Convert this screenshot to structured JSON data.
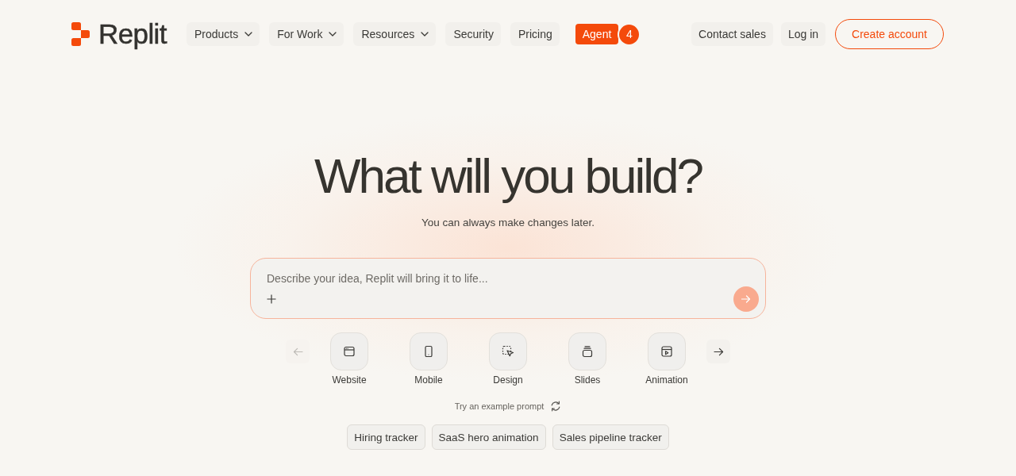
{
  "logo": {
    "text": "Replit"
  },
  "nav": {
    "items": [
      {
        "label": "Products",
        "kind": "dropdown"
      },
      {
        "label": "For Work",
        "kind": "dropdown"
      },
      {
        "label": "Resources",
        "kind": "dropdown"
      },
      {
        "label": "Security",
        "kind": "link"
      },
      {
        "label": "Pricing",
        "kind": "link"
      }
    ],
    "agent": {
      "label": "Agent",
      "badge": "4"
    }
  },
  "header_actions": [
    {
      "label": "Contact sales",
      "kind": "plain"
    },
    {
      "label": "Log in",
      "kind": "plain"
    },
    {
      "label": "Create account",
      "kind": "outline"
    }
  ],
  "hero": {
    "title": "What will you build?",
    "subtitle": "You can always make changes later."
  },
  "prompt": {
    "placeholder": "Describe your idea, Replit will bring it to life...",
    "send_disabled": true
  },
  "carousel": {
    "prev_disabled": true,
    "next_disabled": false,
    "categories": [
      {
        "label": "Website",
        "kind": "website"
      },
      {
        "label": "Mobile",
        "kind": "mobile"
      },
      {
        "label": "Design",
        "kind": "design"
      },
      {
        "label": "Slides",
        "kind": "slides"
      },
      {
        "label": "Animation",
        "kind": "animation"
      }
    ]
  },
  "examples": {
    "label": "Try an example prompt",
    "prompts": [
      "Hiring tracker",
      "SaaS hero animation",
      "Sales pipeline tracker"
    ]
  }
}
